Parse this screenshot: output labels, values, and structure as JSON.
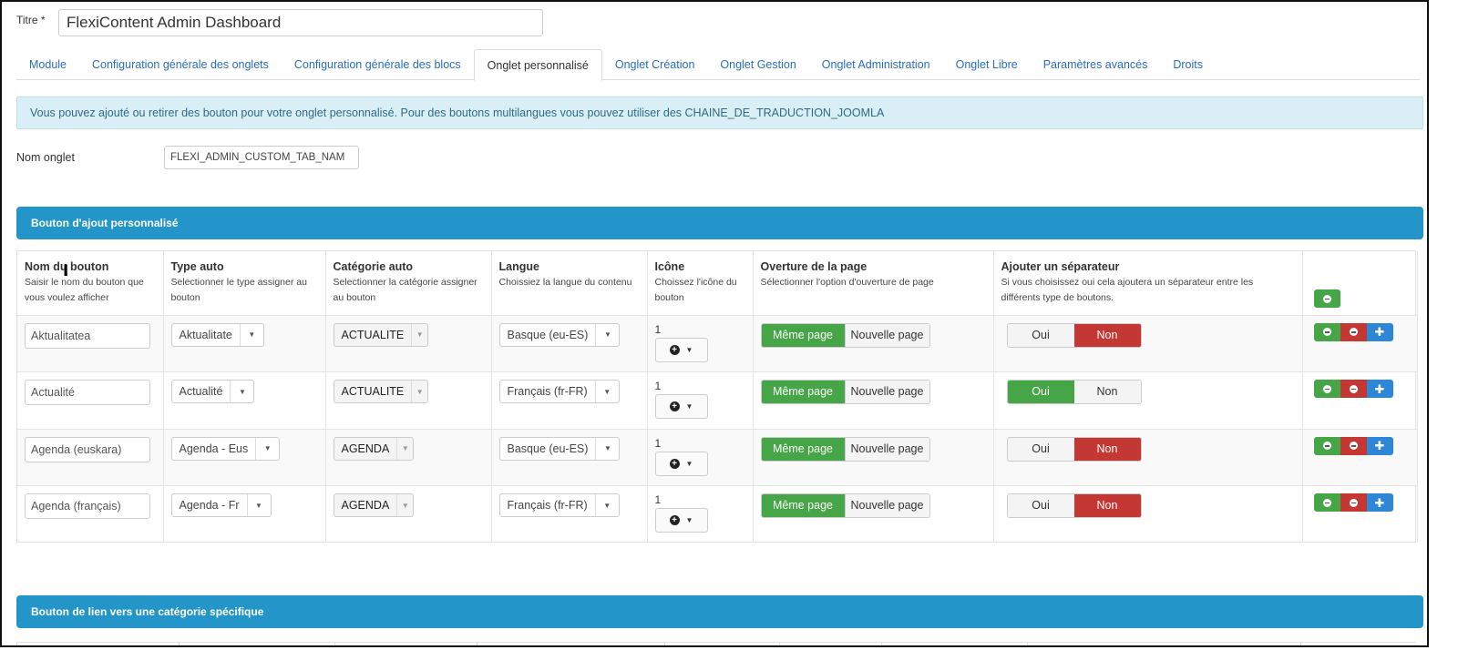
{
  "form": {
    "title_label": "Titre *",
    "title_value": "FlexiContent Admin Dashboard"
  },
  "tabs": [
    {
      "label": "Module"
    },
    {
      "label": "Configuration générale des onglets"
    },
    {
      "label": "Configuration générale des blocs"
    },
    {
      "label": "Onglet personnalisé",
      "active": true
    },
    {
      "label": "Onglet Création"
    },
    {
      "label": "Onglet Gestion"
    },
    {
      "label": "Onglet Administration"
    },
    {
      "label": "Onglet Libre"
    },
    {
      "label": "Paramètres avancés"
    },
    {
      "label": "Droits"
    }
  ],
  "alert": {
    "text": "Vous pouvez ajouté ou retirer des bouton pour votre onglet personnalisé. Pour des boutons multilangues vous pouvez utiliser des CHAINE_DE_TRADUCTION_JOOMLA"
  },
  "tab_name": {
    "label": "Nom onglet",
    "value": "FLEXI_ADMIN_CUSTOM_TAB_NAM"
  },
  "panel1": {
    "title": "Bouton d'ajout personnalisé",
    "headers": {
      "name": {
        "title": "Nom du bouton",
        "sub": "Saisir le nom du bouton que vous voulez afficher"
      },
      "type": {
        "title": "Type auto",
        "sub": "Selectionner le type assigner au bouton"
      },
      "category": {
        "title": "Catégorie auto",
        "sub": "Selectionner la catégorie assigner au bouton"
      },
      "language": {
        "title": "Langue",
        "sub": "Choissiez la langue du contenu"
      },
      "icon": {
        "title": "Icône",
        "sub": "Choissez l'icône du bouton"
      },
      "opening": {
        "title": "Overture de la page",
        "sub": "Sélectionner l'option d'ouverture de page"
      },
      "separator": {
        "title": "Ajouter un séparateur",
        "sub": "Si vous choisissez oui cela ajoutera un séparateur entre les différents type de boutons."
      }
    },
    "rows": [
      {
        "name": "Aktualitatea",
        "type": "Aktualitate",
        "category": "ACTUALITE",
        "language": "Basque (eu-ES)",
        "icon_num": "1",
        "page_same": "Même page",
        "page_new": "Nouvelle page",
        "sep_yes": "Oui",
        "sep_no": "Non",
        "separator": "Non"
      },
      {
        "name": "Actualité",
        "type": "Actualité",
        "category": "ACTUALITE",
        "language": "Français (fr-FR)",
        "icon_num": "1",
        "page_same": "Même page",
        "page_new": "Nouvelle page",
        "sep_yes": "Oui",
        "sep_no": "Non",
        "separator": "Oui"
      },
      {
        "name": "Agenda (euskara)",
        "type": "Agenda - Eus",
        "category": "AGENDA",
        "language": "Basque (eu-ES)",
        "icon_num": "1",
        "page_same": "Même page",
        "page_new": "Nouvelle page",
        "sep_yes": "Oui",
        "sep_no": "Non",
        "separator": "Non"
      },
      {
        "name": "Agenda (français)",
        "type": "Agenda - Fr",
        "category": "AGENDA",
        "language": "Français (fr-FR)",
        "icon_num": "1",
        "page_same": "Même page",
        "page_new": "Nouvelle page",
        "sep_yes": "Oui",
        "sep_no": "Non",
        "separator": "Non"
      }
    ]
  },
  "panel2": {
    "title": "Bouton de lien vers une catégorie spécifique"
  },
  "colors": {
    "panel_blue": "#2395c9",
    "green": "#46a546",
    "red": "#c43833",
    "blue": "#2e86d6",
    "link": "#2a6ebb"
  }
}
